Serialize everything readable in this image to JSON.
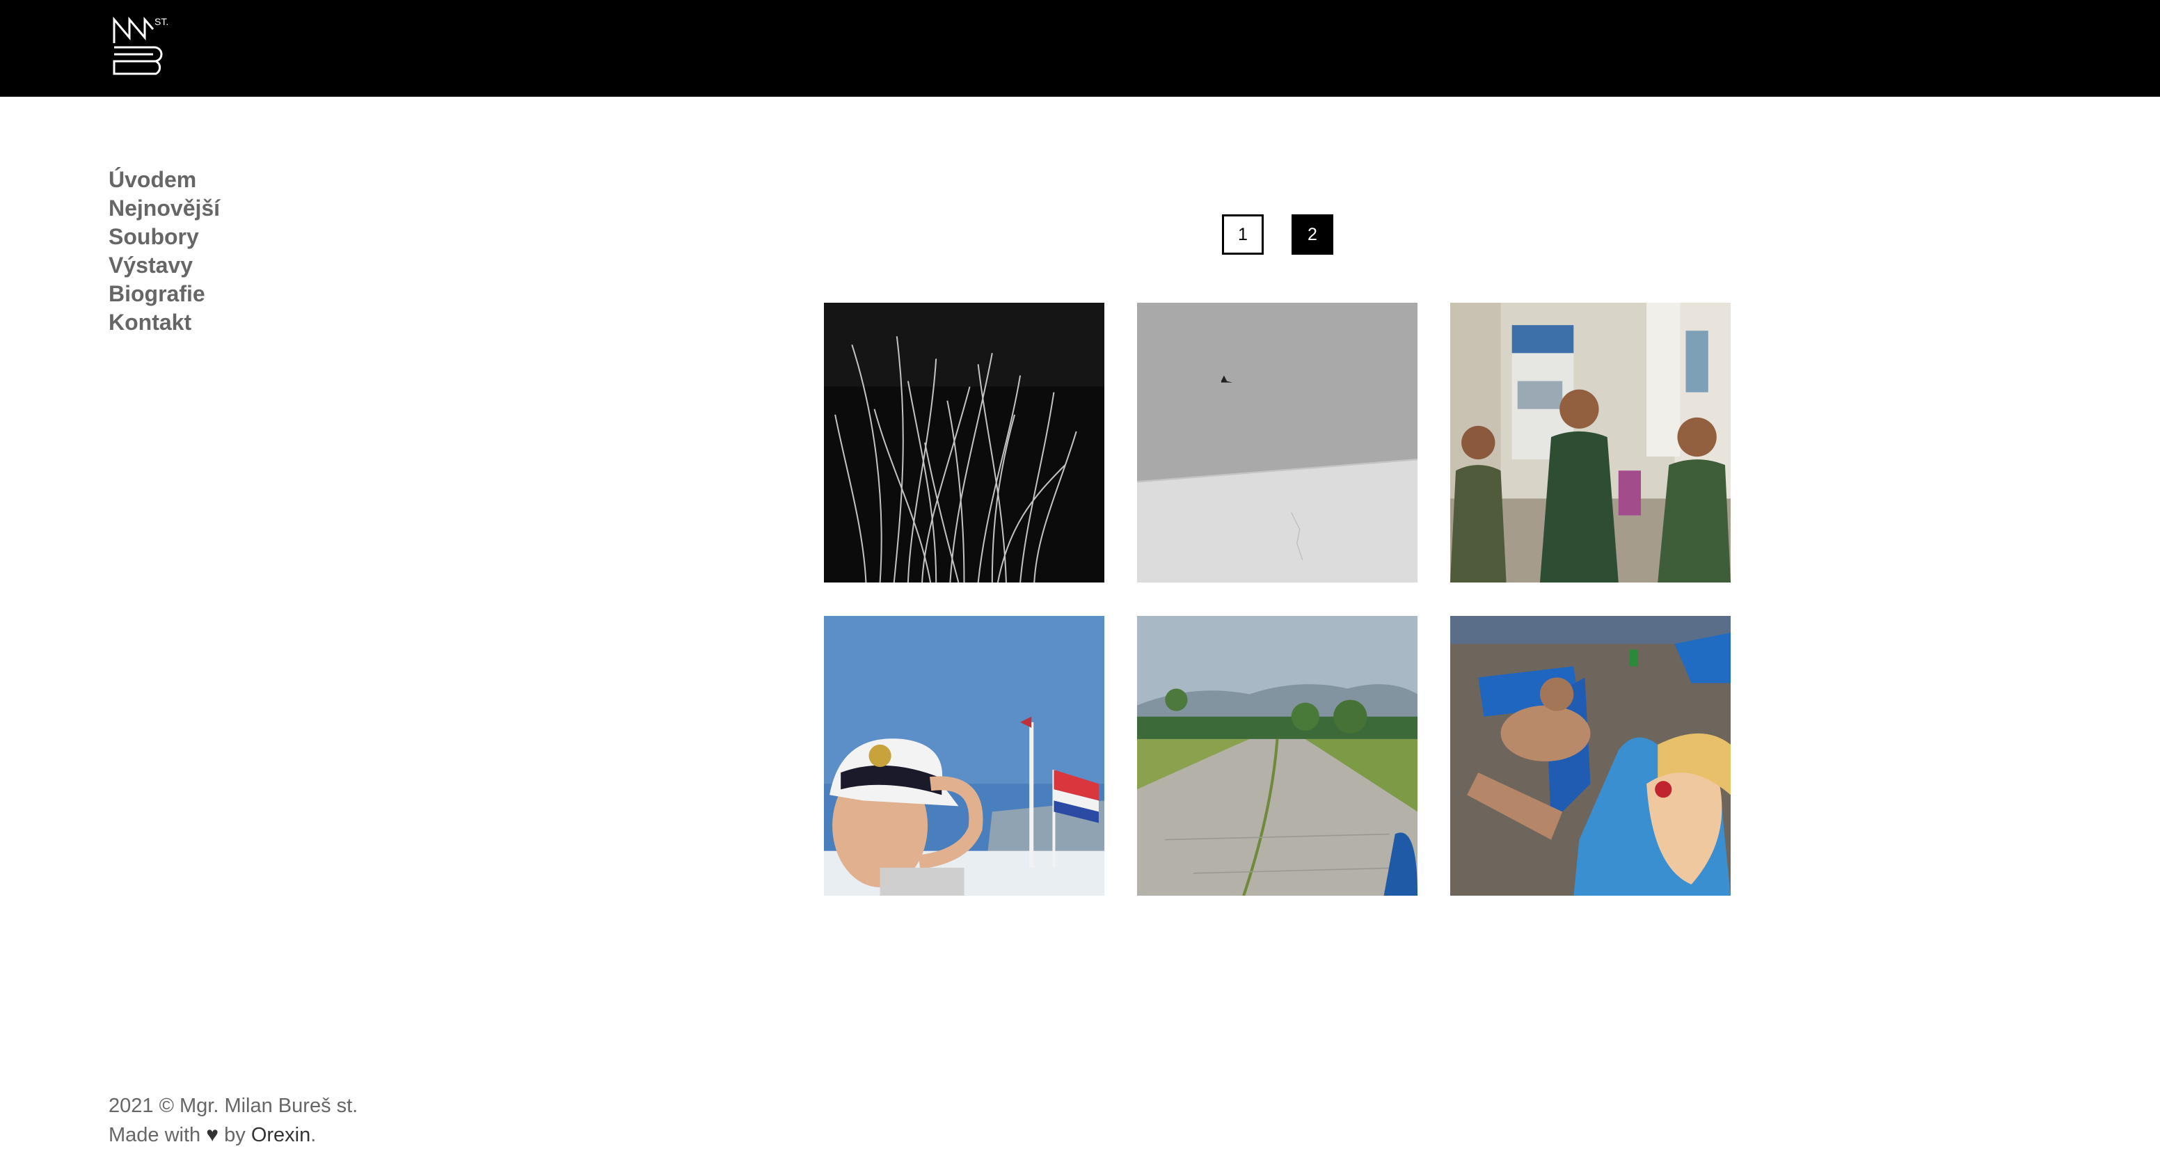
{
  "header": {
    "logo_icon": "ms-monogram-logo-icon"
  },
  "nav": {
    "items": [
      {
        "label": "Úvodem"
      },
      {
        "label": "Nejnovější"
      },
      {
        "label": "Soubory"
      },
      {
        "label": "Výstavy"
      },
      {
        "label": "Biografie"
      },
      {
        "label": "Kontakt"
      }
    ]
  },
  "pagination": {
    "pages": [
      "1",
      "2"
    ],
    "current": "2"
  },
  "gallery": {
    "photos": [
      {
        "icon": "photo-dry-grass-bw"
      },
      {
        "icon": "photo-bird-over-snow-bw"
      },
      {
        "icon": "photo-three-children-street"
      },
      {
        "icon": "photo-boy-captain-hat"
      },
      {
        "icon": "photo-cracked-runway"
      },
      {
        "icon": "photo-man-sunbathing-beach"
      }
    ]
  },
  "footer": {
    "copyright": "2021 © Mgr. Milan Bureš st.",
    "made_with": "Made with",
    "heart": "♥",
    "by": "by",
    "author_link": "Orexin",
    "period": "."
  },
  "colors": {
    "topbar": "#000000",
    "nav_text": "#666666",
    "footer_text": "#666666"
  }
}
